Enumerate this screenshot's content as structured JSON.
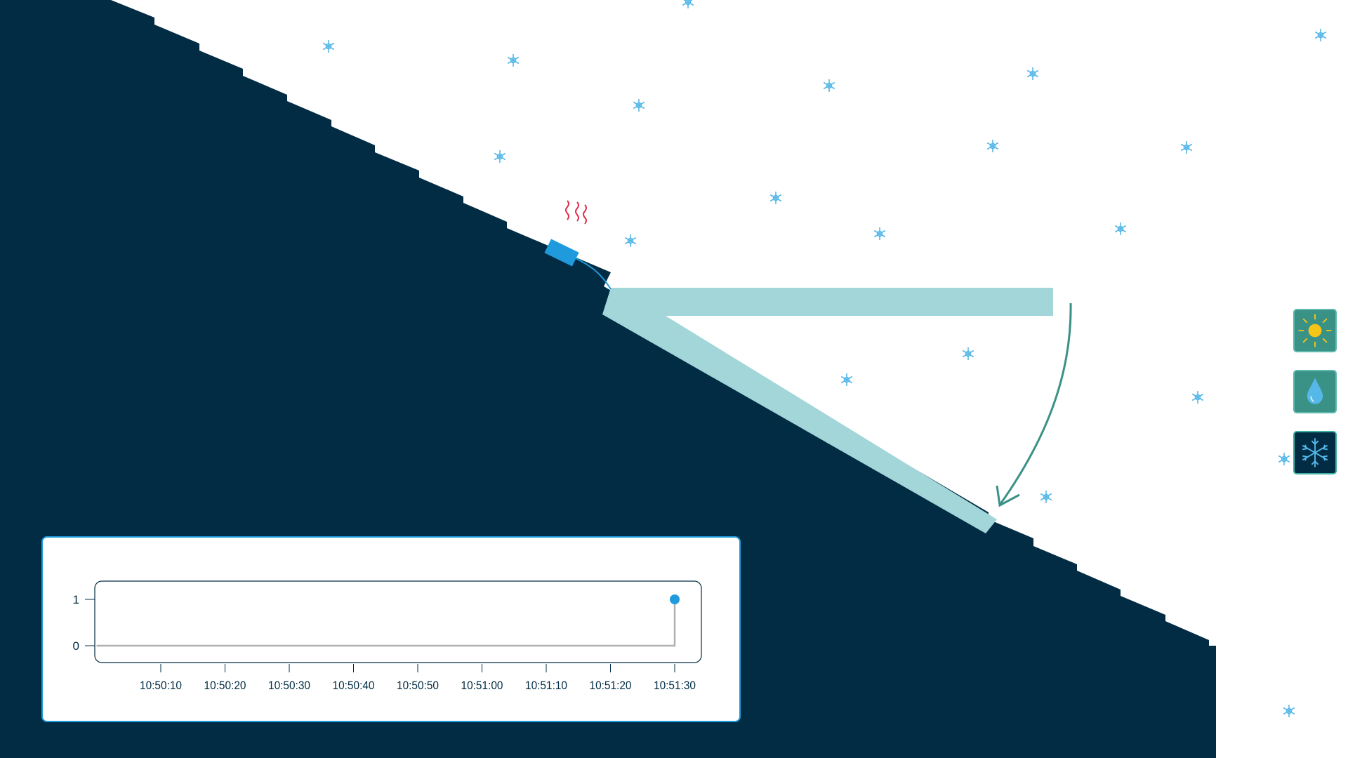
{
  "colors": {
    "roof": "#022c44",
    "hatch": "#a2d6d9",
    "snow": "#56b8e8",
    "arrow": "#3a9185",
    "sensor": "#1f9adc",
    "heat": "#e0304e",
    "panel_border": "#1f9adc",
    "graph_line": "#b0b0b0",
    "graph_point": "#1f9adc"
  },
  "controls": [
    {
      "name": "sunny-weather-button",
      "icon": "sun-icon",
      "active": false
    },
    {
      "name": "rain-weather-button",
      "icon": "water-drop-icon",
      "active": false
    },
    {
      "name": "snow-weather-button",
      "icon": "snowflake-icon",
      "active": true
    }
  ],
  "chart_data": {
    "type": "line",
    "step": true,
    "x_tick_labels": [
      "10:50:10",
      "10:50:20",
      "10:50:30",
      "10:50:40",
      "10:50:50",
      "10:51:00",
      "10:51:10",
      "10:51:20",
      "10:51:30"
    ],
    "y_tick_labels": [
      "1",
      "0"
    ],
    "ylim": [
      0,
      1
    ],
    "series": [
      {
        "points": [
          {
            "x": "10:50:00",
            "y": 0
          },
          {
            "x": "10:51:30",
            "y": 0
          },
          {
            "x": "10:51:30",
            "y": 1
          }
        ]
      }
    ],
    "grid": false
  }
}
